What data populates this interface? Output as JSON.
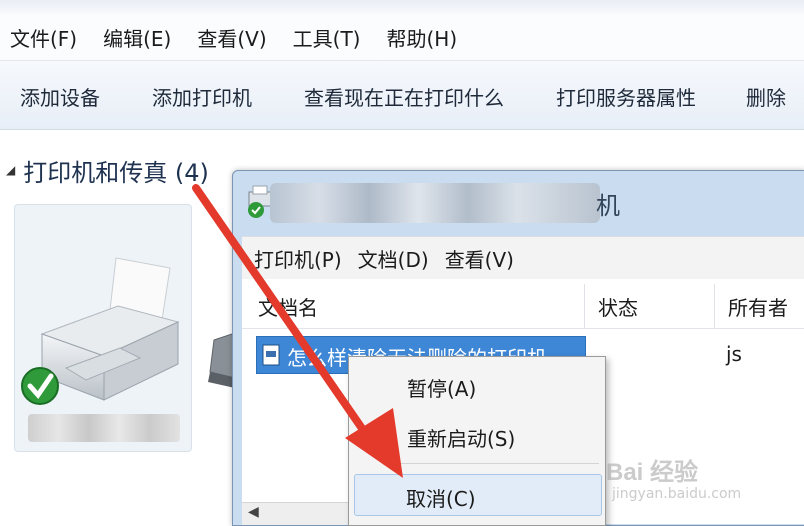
{
  "main_menu": [
    "文件(F)",
    "编辑(E)",
    "查看(V)",
    "工具(T)",
    "帮助(H)"
  ],
  "toolbar": [
    "添加设备",
    "添加打印机",
    "查看现在正在打印什么",
    "打印服务器属性",
    "删除"
  ],
  "section": {
    "title": "打印机和传真 (4)"
  },
  "queue_window": {
    "title_visible_suffix": "机",
    "menu": [
      "打印机(P)",
      "文档(D)",
      "查看(V)"
    ],
    "columns": [
      "文档名",
      "状态",
      "所有者"
    ],
    "row": {
      "document_name": "怎么样清除无法删除的打印机",
      "owner": "js"
    }
  },
  "context_menu": [
    "暂停(A)",
    "重新启动(S)",
    "取消(C)"
  ],
  "watermark": {
    "text": "Bai 经验",
    "sub": "jingyan.baidu.com"
  },
  "colors": {
    "selection": "#3e87d6",
    "arrow": "#e43a2c",
    "window_frame": "#c9dcf0"
  }
}
